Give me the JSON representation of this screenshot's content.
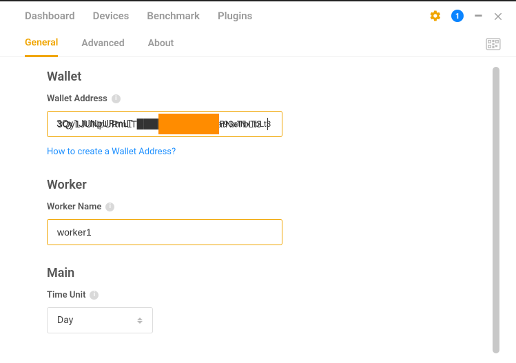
{
  "topnav": {
    "items": [
      "Dashboard",
      "Devices",
      "Benchmark",
      "Plugins"
    ]
  },
  "notification_count": "1",
  "subtabs": {
    "items": [
      "General",
      "Advanced",
      "About"
    ],
    "active_index": 0
  },
  "wallet": {
    "heading": "Wallet",
    "label": "Wallet Address",
    "value_left": "3Qy1JUNpURmLT",
    "value_right": "F9GatNxTbLt3",
    "full_value": "3Qy1JUNpURmLT█████████F9GatNxTbLt3",
    "help_link": "How to create a Wallet Address?"
  },
  "worker": {
    "heading": "Worker",
    "label": "Worker Name",
    "value": "worker1"
  },
  "main": {
    "heading": "Main",
    "label": "Time Unit",
    "selected": "Day"
  }
}
